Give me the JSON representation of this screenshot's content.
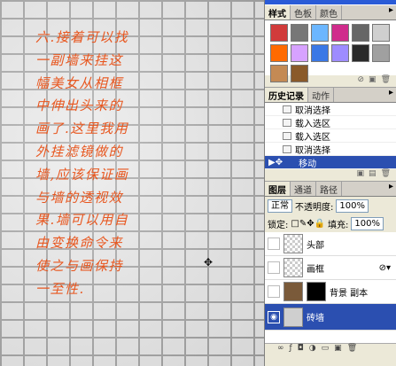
{
  "canvas": {
    "note_lines": [
      "六.接着可以找",
      "一副墙来挂这",
      "幅美女从相框",
      "中伸出头来的",
      "画了.这里我用",
      "外挂滤镜做的",
      "墙,应该保证画",
      "与墙的透视效",
      "果.墙可以用自",
      "由变换命令来",
      "使之与画保持",
      "一至性."
    ]
  },
  "styles_panel": {
    "tabs": [
      "样式",
      "色板",
      "颜色"
    ],
    "swatches": [
      "#d13b3b",
      "#777777",
      "#6bb6ff",
      "#d02c8c",
      "#666666",
      "#cfcfcf",
      "#ff6a00",
      "#d7a2ff",
      "#3a78e6",
      "#9e8cff",
      "#2a2a2a",
      "#a0a0a0",
      "#c48a54",
      "#8a5a2a"
    ]
  },
  "history_panel": {
    "tabs": [
      "历史记录",
      "动作"
    ],
    "rows": [
      "取消选择",
      "载入选区",
      "载入选区",
      "取消选择",
      "移动"
    ]
  },
  "layers_panel": {
    "tabs": [
      "图层",
      "通道",
      "路径"
    ],
    "blend_mode": "正常",
    "opacity_label": "不透明度:",
    "opacity_value": "100%",
    "lock_label": "锁定:",
    "fill_label": "填充:",
    "fill_value": "100%",
    "layers": [
      "头部",
      "画框",
      "背景 副本",
      "砖墙"
    ]
  }
}
